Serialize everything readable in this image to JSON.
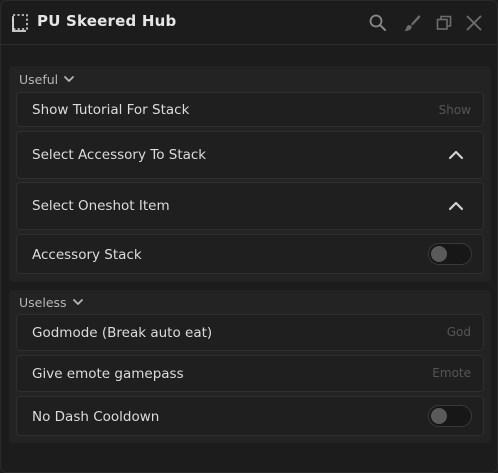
{
  "window": {
    "title": "PU Skeered Hub",
    "title_icon": "select-dashed-icon",
    "controls": [
      "search-icon",
      "brush-icon",
      "restore-icon",
      "close-icon"
    ]
  },
  "sections": [
    {
      "title": "Useful",
      "items": [
        {
          "label": "Show Tutorial For Stack",
          "kind": "button",
          "hint": "Show"
        },
        {
          "label": "Select Accessory To Stack",
          "kind": "dropdown",
          "icon": "chevron-up-icon"
        },
        {
          "label": "Select Oneshot Item",
          "kind": "dropdown",
          "icon": "chevron-up-icon"
        },
        {
          "label": "Accessory Stack",
          "kind": "toggle",
          "state": "off"
        }
      ]
    },
    {
      "title": "Useless",
      "items": [
        {
          "label": "Godmode (Break auto eat)",
          "kind": "button",
          "hint": "God"
        },
        {
          "label": "Give emote gamepass",
          "kind": "button",
          "hint": "Emote"
        },
        {
          "label": "No Dash Cooldown",
          "kind": "toggle",
          "state": "off"
        }
      ]
    }
  ],
  "colors": {
    "background": "#1c1c1c",
    "section": "#232323",
    "row": "#1f1f1f",
    "text": "#dcdcdc",
    "hint": "#555555"
  }
}
